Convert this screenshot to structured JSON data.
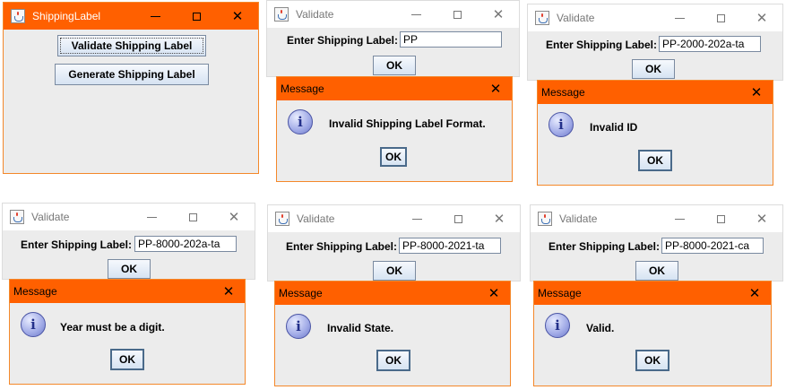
{
  "windows": [
    {
      "title": "ShippingLabel",
      "buttons": [
        "Validate Shipping Label",
        "Generate Shipping Label"
      ]
    },
    {
      "title": "Validate",
      "label": "Enter Shipping Label:",
      "input_value": "PP",
      "ok_label": "OK",
      "dialog": {
        "title": "Message",
        "message": "Invalid Shipping Label Format.",
        "ok_label": "OK"
      }
    },
    {
      "title": "Validate",
      "label": "Enter Shipping Label:",
      "input_value": "PP-2000-202a-ta",
      "ok_label": "OK",
      "dialog": {
        "title": "Message",
        "message": "Invalid ID",
        "ok_label": "OK"
      }
    },
    {
      "title": "Validate",
      "label": "Enter Shipping Label:",
      "input_value": "PP-8000-202a-ta",
      "ok_label": "OK",
      "dialog": {
        "title": "Message",
        "message": "Year must be a digit.",
        "ok_label": "OK"
      }
    },
    {
      "title": "Validate",
      "label": "Enter Shipping Label:",
      "input_value": "PP-8000-2021-ta",
      "ok_label": "OK",
      "dialog": {
        "title": "Message",
        "message": "Invalid State.",
        "ok_label": "OK"
      }
    },
    {
      "title": "Validate",
      "label": "Enter Shipping Label:",
      "input_value": "PP-8000-2021-ca",
      "ok_label": "OK",
      "dialog": {
        "title": "Message",
        "message": "Valid.",
        "ok_label": "OK"
      }
    }
  ],
  "icons": {
    "app": "java-icon",
    "info": "info-icon"
  },
  "info_glyph": "i",
  "colors": {
    "title_active": "#ff6000",
    "window_bg": "#ececec",
    "accent_border": "#f4882a"
  }
}
